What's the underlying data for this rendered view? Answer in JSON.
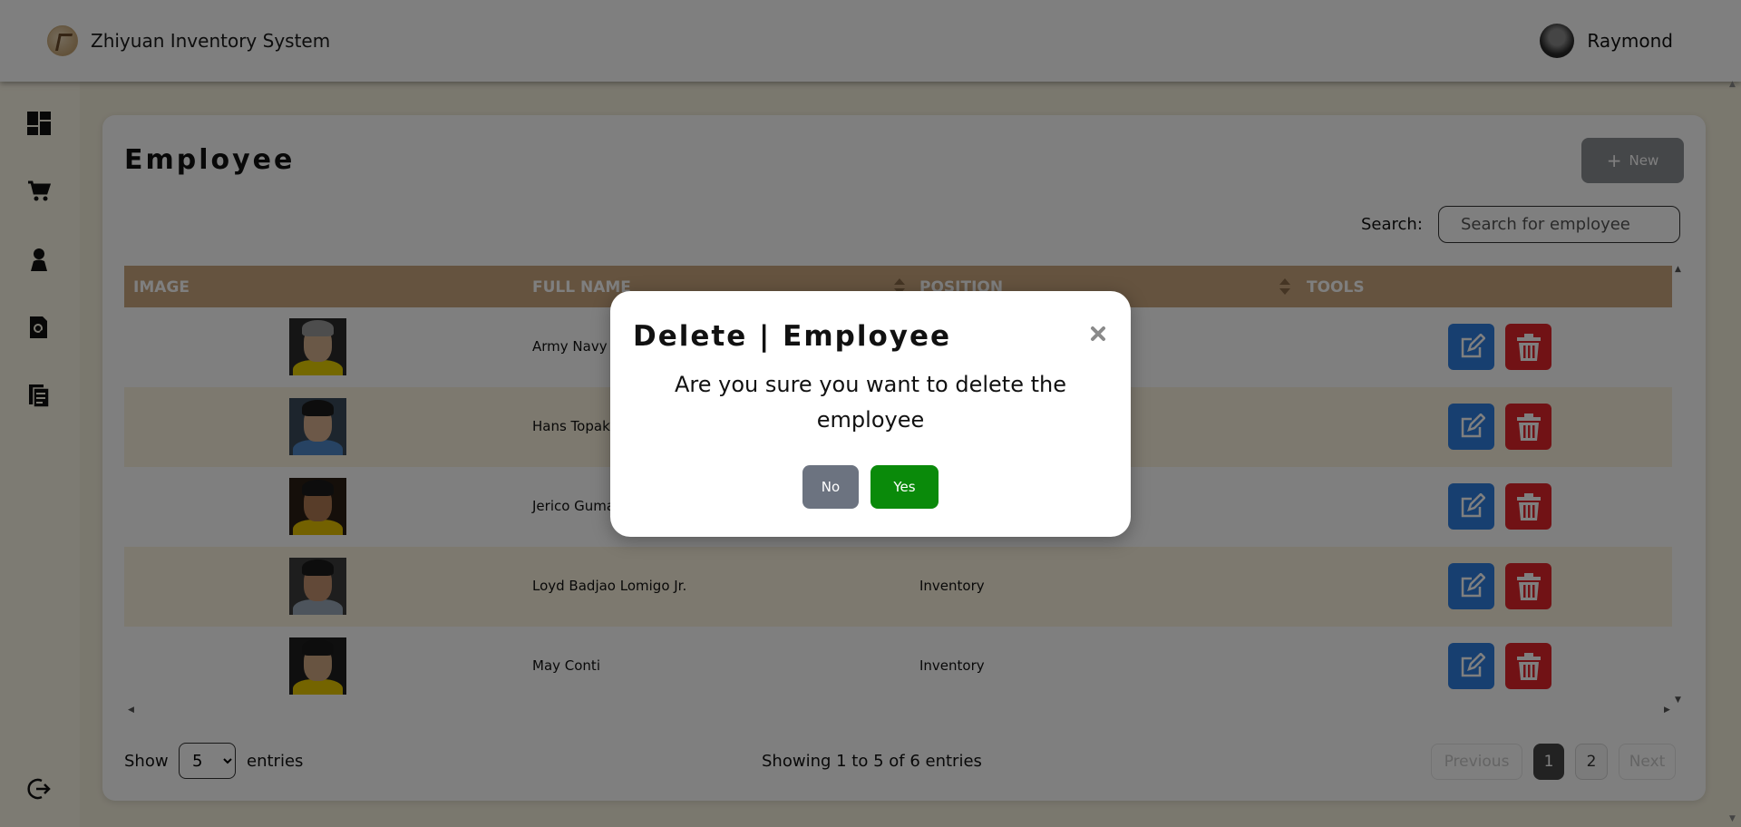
{
  "header": {
    "app_title": "Zhiyuan Inventory System",
    "user_name": "Raymond"
  },
  "sidebar": {
    "items": [
      {
        "icon": "dashboard-icon"
      },
      {
        "icon": "cart-icon"
      },
      {
        "icon": "person-icon"
      },
      {
        "icon": "report-search-icon"
      },
      {
        "icon": "documents-icon"
      },
      {
        "icon": "logout-icon"
      }
    ]
  },
  "main": {
    "page_title": "Employee",
    "new_button_label": "New",
    "search_label": "Search:",
    "search_placeholder": "Search for employee",
    "table": {
      "columns": [
        "IMAGE",
        "FULL NAME",
        "POSITION",
        "TOOLS"
      ],
      "rows": [
        {
          "full_name": "Army Navy",
          "position": ""
        },
        {
          "full_name": "Hans Topak Is",
          "position": ""
        },
        {
          "full_name": "Jerico Gumal",
          "position": ""
        },
        {
          "full_name": "Loyd Badjao Lomigo Jr.",
          "position": "Inventory"
        },
        {
          "full_name": "May Conti",
          "position": "Inventory"
        }
      ]
    },
    "footer": {
      "show_label": "Show",
      "entries_value": "5",
      "entries_label": "entries",
      "info": "Showing 1 to 5 of 6 entries",
      "previous_label": "Previous",
      "pages": [
        "1",
        "2"
      ],
      "active_page": "1",
      "next_label": "Next"
    }
  },
  "modal": {
    "title": "Delete | Employee",
    "message": "Are you sure you want to delete the employee",
    "no_label": "No",
    "yes_label": "Yes"
  },
  "colors": {
    "table_header": "#caa67f",
    "edit_button": "#2f7ee0",
    "delete_button": "#e3242b",
    "yes_button": "#0a8a0a",
    "no_button": "#6c7380"
  }
}
